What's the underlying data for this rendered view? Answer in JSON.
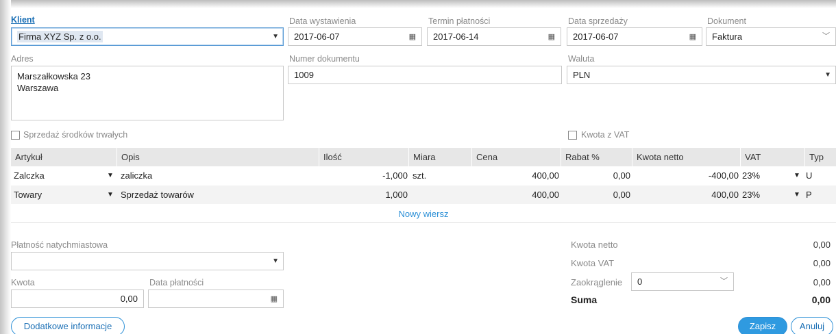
{
  "client": {
    "label": "Klient",
    "value": "Firma XYZ Sp. z o.o."
  },
  "issue_date": {
    "label": "Data wystawienia",
    "value": "2017-06-07"
  },
  "due_date": {
    "label": "Termin płatności",
    "value": "2017-06-14"
  },
  "sale_date": {
    "label": "Data sprzedaży",
    "value": "2017-06-07"
  },
  "document": {
    "label": "Dokument",
    "value": "Faktura"
  },
  "address": {
    "label": "Adres",
    "line1": "Marszałkowska 23",
    "line2": "Warszawa"
  },
  "doc_number": {
    "label": "Numer dokumentu",
    "value": "1009"
  },
  "currency": {
    "label": "Waluta",
    "value": "PLN"
  },
  "fixed_assets": {
    "label": "Sprzedaż środków trwałych"
  },
  "gross_amount": {
    "label": "Kwota z VAT"
  },
  "table": {
    "headers": [
      "Artykuł",
      "Opis",
      "Ilość",
      "Miara",
      "Cena",
      "Rabat %",
      "Kwota netto",
      "VAT",
      "Typ"
    ],
    "rows": [
      {
        "article": "Zalczka",
        "description": "zaliczka",
        "qty": "-1,000",
        "unit": "szt.",
        "price": "400,00",
        "discount": "0,00",
        "net": "-400,00",
        "vat": "23%",
        "type": "U"
      },
      {
        "article": "Towary",
        "description": "Sprzedaż towarów",
        "qty": "1,000",
        "unit": "",
        "price": "400,00",
        "discount": "0,00",
        "net": "400,00",
        "vat": "23%",
        "type": "P"
      }
    ],
    "new_row": "Nowy wiersz"
  },
  "payment": {
    "label": "Płatność natychmiastowa",
    "value": ""
  },
  "amount": {
    "label": "Kwota",
    "value": "0,00"
  },
  "payment_date": {
    "label": "Data płatności",
    "value": ""
  },
  "summary": {
    "net_label": "Kwota netto",
    "net_value": "0,00",
    "vat_label": "Kwota VAT",
    "vat_value": "0,00",
    "rounding_label": "Zaokrąglenie",
    "rounding_option": "0",
    "rounding_value": "0,00",
    "total_label": "Suma",
    "total_value": "0,00"
  },
  "buttons": {
    "additional": "Dodatkowe informacje",
    "save": "Zapisz",
    "cancel": "Anuluj"
  }
}
